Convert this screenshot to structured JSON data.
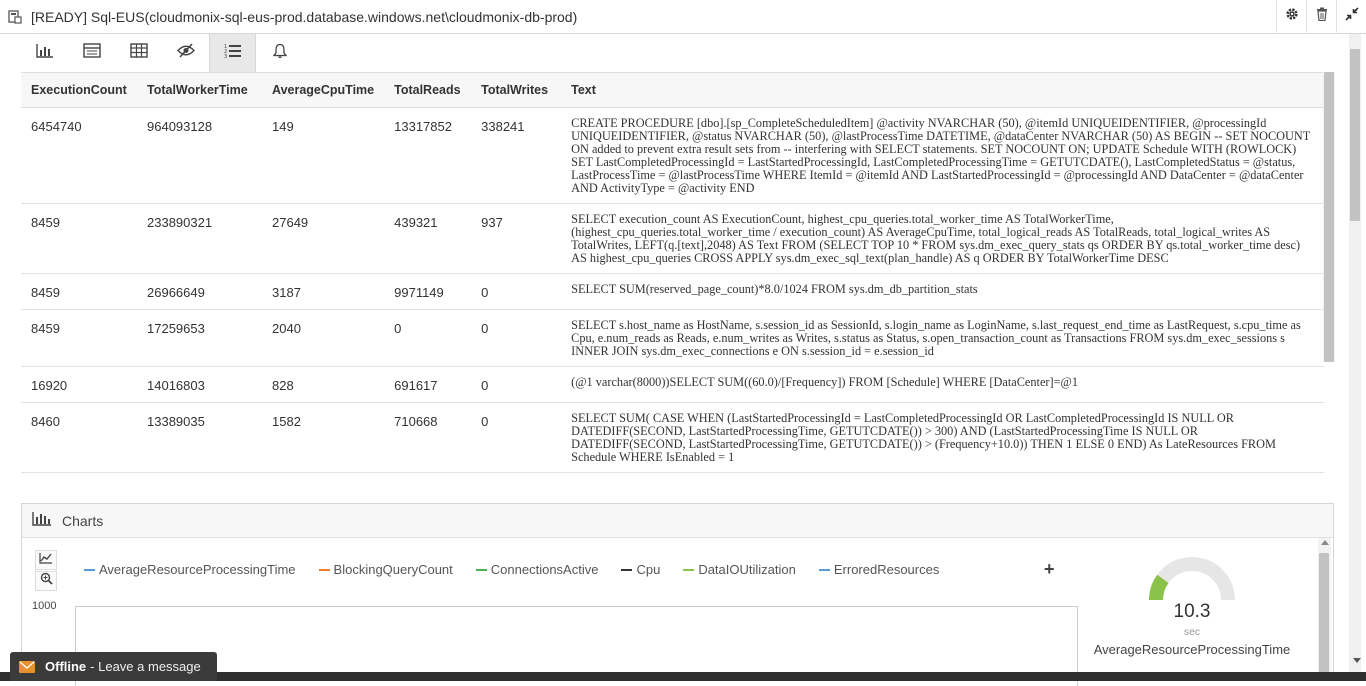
{
  "window": {
    "title": "[READY] Sql-EUS(cloudmonix-sql-eus-prod.database.windows.net\\cloudmonix-db-prod)"
  },
  "toolbar": {
    "tools": [
      "chart-view",
      "table-view",
      "grid-view",
      "eye-view",
      "list-view",
      "alerts"
    ],
    "active": "list-view"
  },
  "table": {
    "columns": [
      "ExecutionCount",
      "TotalWorkerTime",
      "AverageCpuTime",
      "TotalReads",
      "TotalWrites",
      "Text"
    ],
    "rows": [
      [
        "6454740",
        "964093128",
        "149",
        "13317852",
        "338241",
        "CREATE PROCEDURE [dbo].[sp_CompleteScheduledItem] @activity NVARCHAR (50), @itemId UNIQUEIDENTIFIER, @processingId UNIQUEIDENTIFIER, @status NVARCHAR (50), @lastProcessTime DATETIME, @dataCenter NVARCHAR (50) AS BEGIN -- SET NOCOUNT ON added to prevent extra result sets from -- interfering with SELECT statements. SET NOCOUNT ON; UPDATE Schedule WITH (ROWLOCK) SET LastCompletedProcessingId = LastStartedProcessingId, LastCompletedProcessingTime = GETUTCDATE(), LastCompletedStatus = @status, LastProcessTime = @lastProcessTime WHERE ItemId = @itemId AND LastStartedProcessingId = @processingId AND DataCenter = @dataCenter AND ActivityType = @activity END"
      ],
      [
        "8459",
        "233890321",
        "27649",
        "439321",
        "937",
        "SELECT execution_count AS ExecutionCount, highest_cpu_queries.total_worker_time AS TotalWorkerTime, (highest_cpu_queries.total_worker_time / execution_count) AS AverageCpuTime, total_logical_reads AS TotalReads, total_logical_writes AS TotalWrites, LEFT(q.[text],2048) AS Text FROM (SELECT TOP 10 * FROM sys.dm_exec_query_stats qs ORDER BY qs.total_worker_time desc) AS highest_cpu_queries CROSS APPLY sys.dm_exec_sql_text(plan_handle) AS q ORDER BY TotalWorkerTime DESC"
      ],
      [
        "8459",
        "26966649",
        "3187",
        "9971149",
        "0",
        "SELECT SUM(reserved_page_count)*8.0/1024 FROM sys.dm_db_partition_stats"
      ],
      [
        "8459",
        "17259653",
        "2040",
        "0",
        "0",
        "SELECT s.host_name as HostName, s.session_id as SessionId, s.login_name as LoginName, s.last_request_end_time as LastRequest, s.cpu_time as Cpu, e.num_reads as Reads, e.num_writes as Writes, s.status as Status, s.open_transaction_count as Transactions FROM sys.dm_exec_sessions s INNER JOIN sys.dm_exec_connections e ON s.session_id = e.session_id"
      ],
      [
        "16920",
        "14016803",
        "828",
        "691617",
        "0",
        "(@1 varchar(8000))SELECT SUM((60.0)/[Frequency]) FROM [Schedule] WHERE [DataCenter]=@1"
      ],
      [
        "8460",
        "13389035",
        "1582",
        "710668",
        "0",
        "SELECT SUM( CASE WHEN (LastStartedProcessingId = LastCompletedProcessingId OR LastCompletedProcessingId IS NULL OR DATEDIFF(SECOND, LastStartedProcessingTime, GETUTCDATE()) > 300) AND (LastStartedProcessingTime IS NULL OR DATEDIFF(SECOND, LastStartedProcessingTime, GETUTCDATE()) > (Frequency+10.0)) THEN 1 ELSE 0 END) As LateResources FROM Schedule WHERE IsEnabled = 1"
      ]
    ]
  },
  "charts": {
    "title": "Charts",
    "legend": [
      {
        "name": "AverageResourceProcessingTime",
        "color": "#5b9bd5"
      },
      {
        "name": "BlockingQueryCount",
        "color": "#ed7d31"
      },
      {
        "name": "ConnectionsActive",
        "color": "#4caf50"
      },
      {
        "name": "Cpu",
        "color": "#333333"
      },
      {
        "name": "DataIOUtilization",
        "color": "#8bc34a"
      },
      {
        "name": "ErroredResources",
        "color": "#5b9bd5"
      }
    ],
    "add_label": "+",
    "y_tick": "1000",
    "gauge": {
      "value": "10.3",
      "value_numeric": 10.3,
      "unit": "sec",
      "name": "AverageResourceProcessingTime",
      "fill_fraction": 0.2,
      "fill_color": "#8bc34a",
      "track_color": "#e6e6e6"
    }
  },
  "chat": {
    "status": "Offline",
    "message": "- Leave a message",
    "accent": "#e8902c"
  }
}
